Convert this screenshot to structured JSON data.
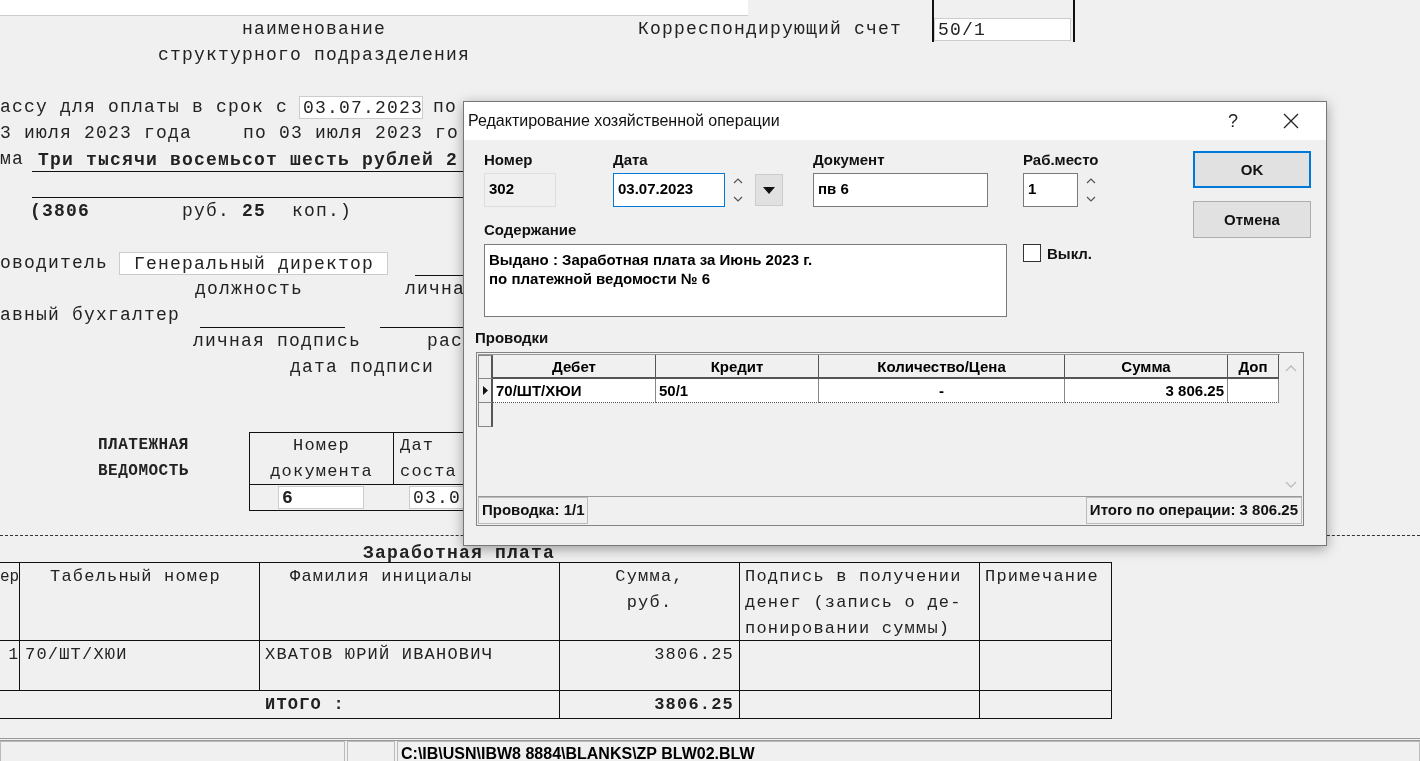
{
  "document": {
    "subdivision_caption": [
      "наименование",
      "структурного подразделения"
    ],
    "corr_account": {
      "label": "Корреспондирующий счет",
      "value": "50/1"
    },
    "payment_term": {
      "prefix": "ассу для оплаты в срок с",
      "from": "03.07.2023",
      "to_label": "по"
    },
    "period": {
      "from": "3 июля 2023 года",
      "to": "по 03 июля 2023 го"
    },
    "amount_words": {
      "label": "ма",
      "value": "Три тысячи восемьсот шесть рублей 2"
    },
    "amount_digits": {
      "rub": "(3806",
      "rub_label": "руб.",
      "kop": "25",
      "kop_label": "коп.)"
    },
    "director": {
      "label": "оводитель",
      "position": "Генеральный директор",
      "position_caption": "должность",
      "signature_caption": "лична"
    },
    "accountant": {
      "label": "авный бухгалтер",
      "signature_caption": "личная подпись",
      "decoding_caption": "рас",
      "date_caption": "дата подписи"
    },
    "statement": {
      "title": [
        "ПЛАТЕЖНАЯ",
        "ВЕДОМОСТЬ"
      ],
      "headers": [
        [
          "Номер",
          "документа"
        ],
        [
          "Дат",
          "соста"
        ]
      ],
      "values": [
        "6",
        "03.0"
      ]
    },
    "table": {
      "title": "Заработная плата",
      "columns": [
        [
          "ер"
        ],
        [
          "Табельный номер"
        ],
        [
          "Фамилия инициалы"
        ],
        [
          "Сумма,",
          "руб."
        ],
        [
          "Подпись в получении",
          "денег (запись о де-",
          "понировании суммы)"
        ],
        [
          "Примечание"
        ]
      ],
      "rows": [
        {
          "number": "1",
          "tab_number": "70/ШТ/ХЮИ",
          "name": "ХВАТОВ ЮРИЙ ИВАНОВИЧ",
          "sum": "3806.25"
        }
      ],
      "total": {
        "label": "ИТОГО :",
        "sum": "3806.25"
      }
    }
  },
  "status_bar": {
    "path": "C:\\IB\\USN\\IBW8 8884\\BLANKS\\ZP BLW02.BLW"
  },
  "dialog": {
    "title": "Редактирование хозяйственной операции",
    "help": "?",
    "fields": [
      {
        "kind": "readonly",
        "label": "Номер",
        "value": "302",
        "focused": false
      },
      {
        "kind": "date",
        "label": "Дата",
        "value": "03.07.2023",
        "focused": true
      },
      {
        "kind": "text",
        "label": "Документ",
        "value": "пв 6",
        "focused": false
      },
      {
        "kind": "spin",
        "label": "Раб.место",
        "value": "1",
        "focused": false
      }
    ],
    "content": {
      "label": "Содержание",
      "lines": [
        "Выдано : Заработная плата за Июнь 2023 г.",
        "по платежной ведомости № 6"
      ]
    },
    "off": {
      "label": "Выкл.",
      "checked": false
    },
    "buttons": [
      {
        "label": "OK",
        "default": true
      },
      {
        "label": "Отмена",
        "default": false
      }
    ],
    "entries": {
      "label": "Проводки",
      "columns": [
        "Дебет",
        "Кредит",
        "Количество/Цена",
        "Сумма",
        "Доп"
      ],
      "rows": [
        {
          "selected": true,
          "cells": [
            "70/ШТ/ХЮИ",
            "50/1",
            "-",
            "3 806.25"
          ]
        }
      ],
      "counter": "Проводка: 1/1",
      "total": "Итого по операции: 3 806.25"
    }
  }
}
